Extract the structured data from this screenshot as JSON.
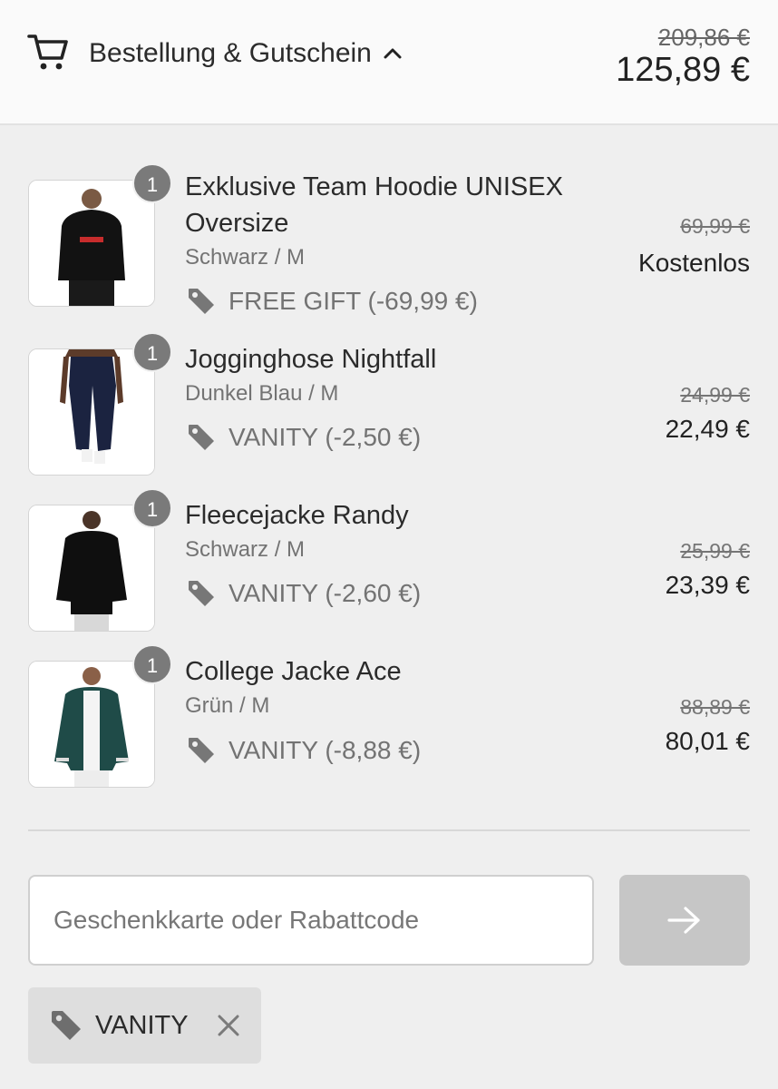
{
  "header": {
    "title": "Bestellung & Gutschein",
    "original_total": "209,86 €",
    "total": "125,89 €"
  },
  "items": [
    {
      "quantity": "1",
      "name": "Exklusive Team Hoodie UNISEX Oversize",
      "variant": "Schwarz / M",
      "discount": "FREE GIFT (-69,99 €)",
      "old_price": "69,99 €",
      "price": "Kostenlos"
    },
    {
      "quantity": "1",
      "name": "Jogginghose Nightfall",
      "variant": "Dunkel Blau / M",
      "discount": "VANITY (-2,50 €)",
      "old_price": "24,99 €",
      "price": "22,49 €"
    },
    {
      "quantity": "1",
      "name": "Fleecejacke Randy",
      "variant": "Schwarz / M",
      "discount": "VANITY (-2,60 €)",
      "old_price": "25,99 €",
      "price": "23,39 €"
    },
    {
      "quantity": "1",
      "name": "College Jacke Ace",
      "variant": "Grün / M",
      "discount": "VANITY (-8,88 €)",
      "old_price": "88,89 €",
      "price": "80,01 €"
    }
  ],
  "discount_form": {
    "placeholder": "Geschenkkarte oder Rabattcode",
    "value": ""
  },
  "applied_code": {
    "label": "VANITY"
  },
  "icons": {
    "cart": "cart-icon",
    "chevron": "chevron-up-icon",
    "tag": "tag-icon",
    "arrow": "arrow-right-icon",
    "remove": "close-icon"
  }
}
